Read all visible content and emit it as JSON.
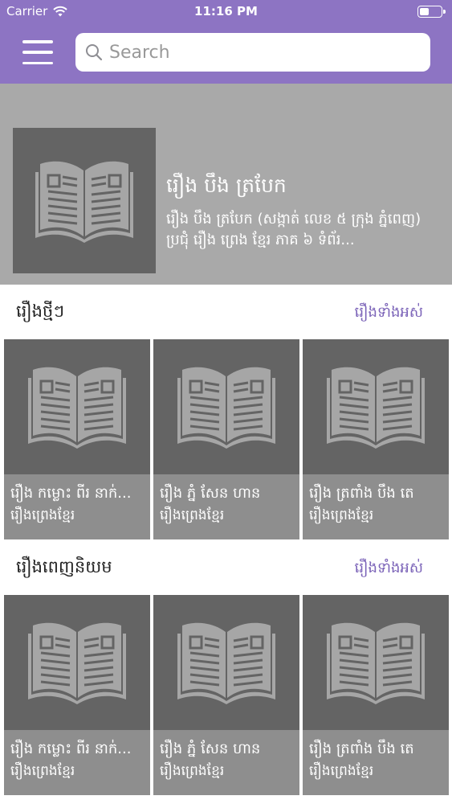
{
  "status_bar": {
    "carrier": "Carrier",
    "time": "11:16 PM"
  },
  "search": {
    "placeholder": "Search"
  },
  "featured": {
    "title": "រឿង បឹង ត្របែក",
    "description": "រឿង បឹង ត្របែក (សង្កាត់ លេខ ៥ ក្រុង ភ្នំពេញ) ប្រជុំ រឿង ព្រេង ខ្មែរ ភាគ ៦ ទំព័រ..."
  },
  "sections": [
    {
      "title": "រឿងថ្មីៗ",
      "link": "រឿងទាំងអស់",
      "items": [
        {
          "title": "រឿង កម្លោះ ពីរ នាក់...",
          "category": "រឿងព្រេងខ្មែរ"
        },
        {
          "title": "រឿង ភ្នំ សែន ហាន",
          "category": "រឿងព្រេងខ្មែរ"
        },
        {
          "title": "រឿង ត្រពាំង បឹង តេ",
          "category": "រឿងព្រេងខ្មែរ"
        }
      ]
    },
    {
      "title": "រឿងពេញនិយម",
      "link": "រឿងទាំងអស់",
      "items": [
        {
          "title": "រឿង កម្លោះ ពីរ នាក់...",
          "category": "រឿងព្រេងខ្មែរ"
        },
        {
          "title": "រឿង ភ្នំ សែន ហាន",
          "category": "រឿងព្រេងខ្មែរ"
        },
        {
          "title": "រឿង ត្រពាំង បឹង តេ",
          "category": "រឿងព្រេងខ្មែរ"
        }
      ]
    }
  ],
  "icons": {
    "menu": "hamburger-menu-icon",
    "search": "search-icon",
    "book": "open-book-icon"
  },
  "colors": {
    "header": "#8d74c3",
    "link": "#7b63b8",
    "featured_bg": "#a9a9a9",
    "cover_bg": "#646464"
  }
}
